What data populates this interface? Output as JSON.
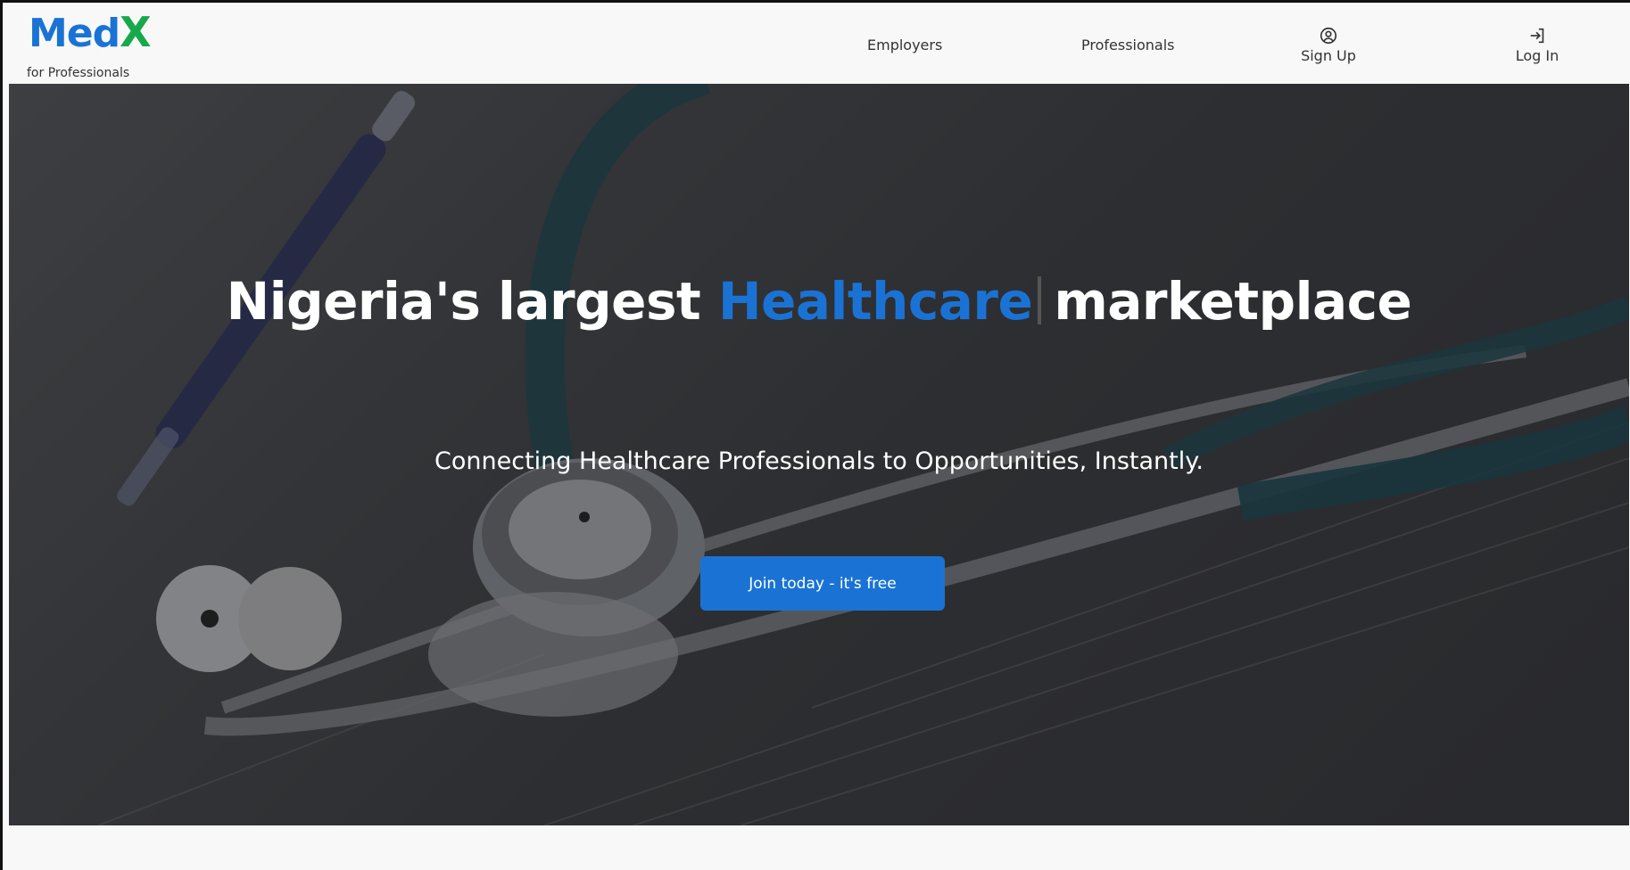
{
  "brand": {
    "logo_med": "Med",
    "logo_x": "X",
    "tagline": "for Professionals",
    "colors": {
      "blue": "#1a73d4",
      "green": "#18a84c"
    }
  },
  "nav": {
    "employers": "Employers",
    "professionals": "Professionals",
    "signup": {
      "label": "Sign Up",
      "icon": "user-circle-icon"
    },
    "login": {
      "label": "Log In",
      "icon": "login-arrow-icon"
    }
  },
  "hero": {
    "title_before": "Nigeria's largest ",
    "title_accent": "Healthcare",
    "title_after": "marketplace",
    "subtitle": "Connecting Healthcare Professionals to Opportunities, Instantly.",
    "cta_label": "Join today - it's free",
    "background_image": "stethoscope-on-medical-chart-photo"
  }
}
